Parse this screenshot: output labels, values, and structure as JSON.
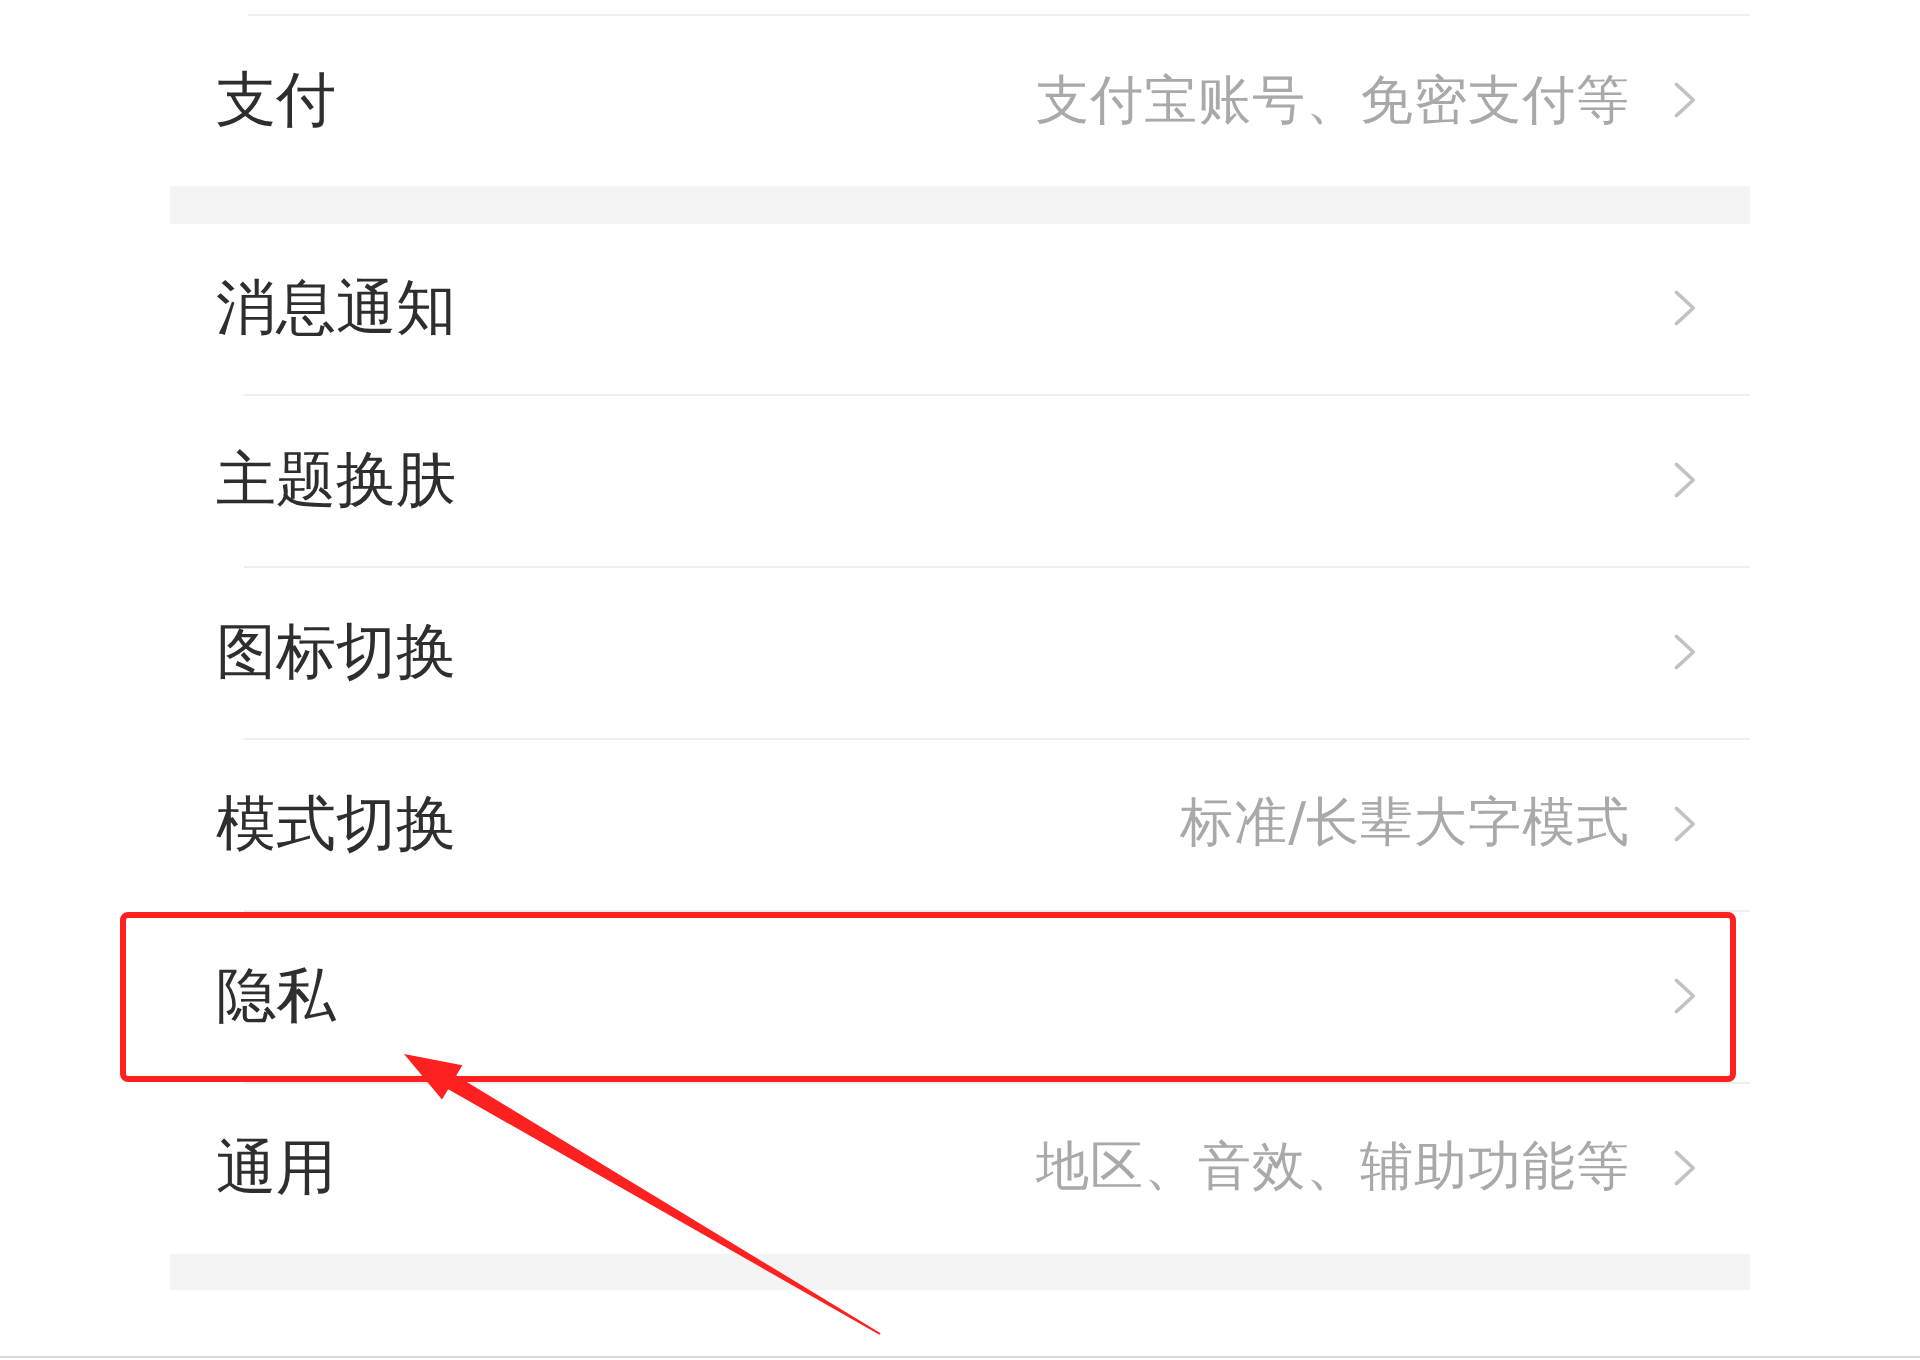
{
  "sections": [
    {
      "items": [
        {
          "label": "支付",
          "value": "支付宝账号、免密支付等",
          "highlighted": false
        }
      ]
    },
    {
      "items": [
        {
          "label": "消息通知",
          "highlighted": false
        },
        {
          "label": "主题换肤",
          "highlighted": false
        },
        {
          "label": "图标切换",
          "highlighted": false
        },
        {
          "label": "模式切换",
          "value": "标准/长辈大字模式",
          "highlighted": false
        },
        {
          "label": "隐私",
          "highlighted": true
        },
        {
          "label": "通用",
          "value": "地区、音效、辅助功能等",
          "highlighted": false
        }
      ]
    }
  ]
}
